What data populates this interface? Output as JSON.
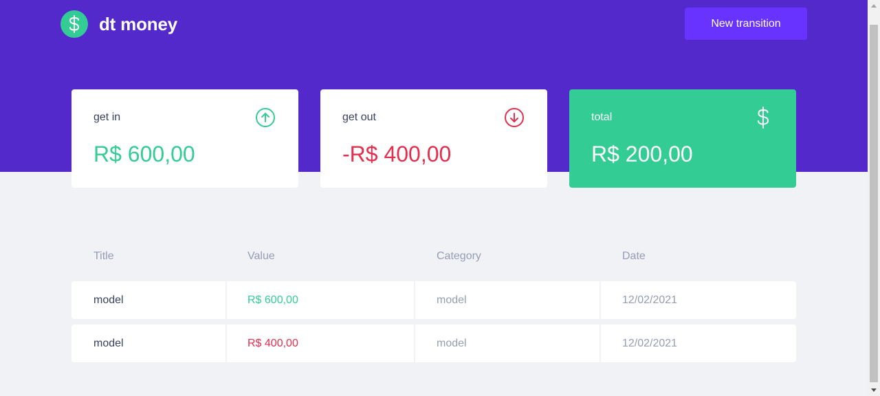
{
  "app": {
    "logo_text": "dt money",
    "new_button_label": "New transition"
  },
  "summary": {
    "income": {
      "label": "get in",
      "value": "R$ 600,00",
      "icon": "arrow-up-circle-icon"
    },
    "outcome": {
      "label": "get out",
      "value": "-R$ 400,00",
      "icon": "arrow-down-circle-icon"
    },
    "total": {
      "label": "total",
      "value": "R$ 200,00",
      "icon": "dollar-icon"
    }
  },
  "table": {
    "headers": [
      "Title",
      "Value",
      "Category",
      "Date"
    ],
    "rows": [
      {
        "title": "model",
        "value": "R$ 600,00",
        "category": "model",
        "date": "12/02/2021",
        "type": "deposit"
      },
      {
        "title": "model",
        "value": "R$ 400,00",
        "category": "model",
        "date": "12/02/2021",
        "type": "withdraw"
      }
    ]
  },
  "colors": {
    "header_bg": "#5429cc",
    "button_bg": "#6933ff",
    "green": "#33cc95",
    "red": "#e52e4d",
    "text_title": "#363f5f",
    "text_body": "#969cb3",
    "page_bg": "#f0f2f5"
  }
}
